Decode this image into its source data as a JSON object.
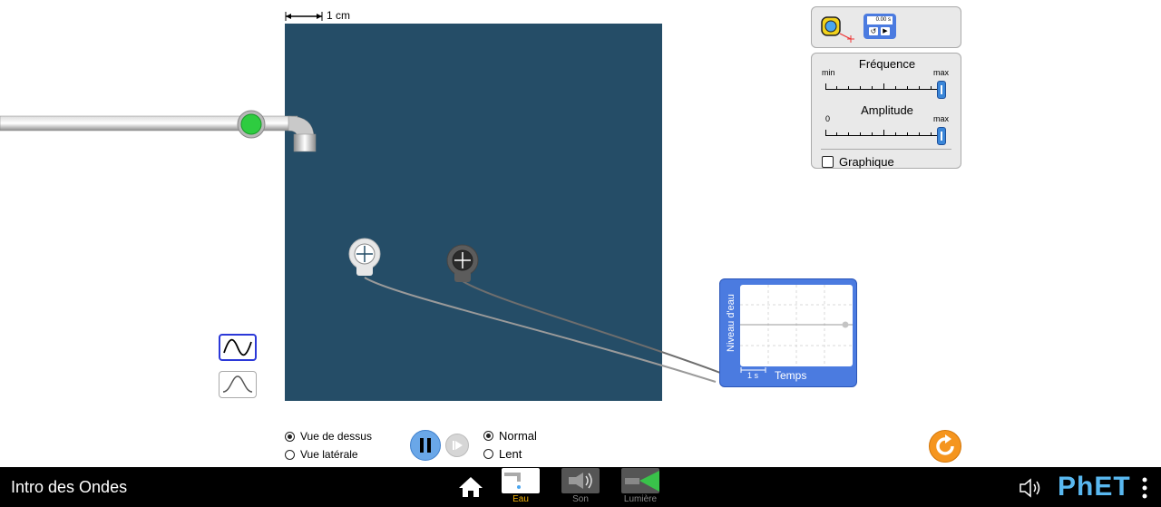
{
  "scale": {
    "label": "1 cm"
  },
  "icons": {
    "measuring_tape": "measuring-tape-icon",
    "stopwatch": "stopwatch-icon",
    "home": "home-icon",
    "sound": "speaker-icon",
    "menu": "kebab-menu-icon",
    "reset": "reset-all-icon"
  },
  "tools": {
    "stopwatch_readout": "0.00 s"
  },
  "controls": {
    "frequency": {
      "title": "Fréquence",
      "min_label": "min",
      "max_label": "max",
      "value_fraction": 1.0
    },
    "amplitude": {
      "title": "Amplitude",
      "min_label": "0",
      "max_label": "max",
      "value_fraction": 1.0
    },
    "graph_checkbox": {
      "label": "Graphique",
      "checked": false
    }
  },
  "graph": {
    "y_label": "Niveau d'eau",
    "x_label": "Temps",
    "time_unit": "1 s"
  },
  "view": {
    "options": [
      "Vue de dessus",
      "Vue latérale"
    ],
    "selected": "Vue de dessus"
  },
  "speed": {
    "options": [
      "Normal",
      "Lent"
    ],
    "selected": "Normal"
  },
  "nav": {
    "app_title": "Intro des Ondes",
    "screens": [
      {
        "label": "Eau",
        "selected": true
      },
      {
        "label": "Son",
        "selected": false
      },
      {
        "label": "Lumière",
        "selected": false
      }
    ],
    "brand": "PhET"
  },
  "colors": {
    "water": "#254d67",
    "accent": "#f5b40a",
    "panel": "#e9e9e9",
    "graph": "#4b7be0",
    "play_button": "#6aa7e8",
    "reset_button": "#f5951e",
    "faucet_button": "#2ecc40"
  }
}
